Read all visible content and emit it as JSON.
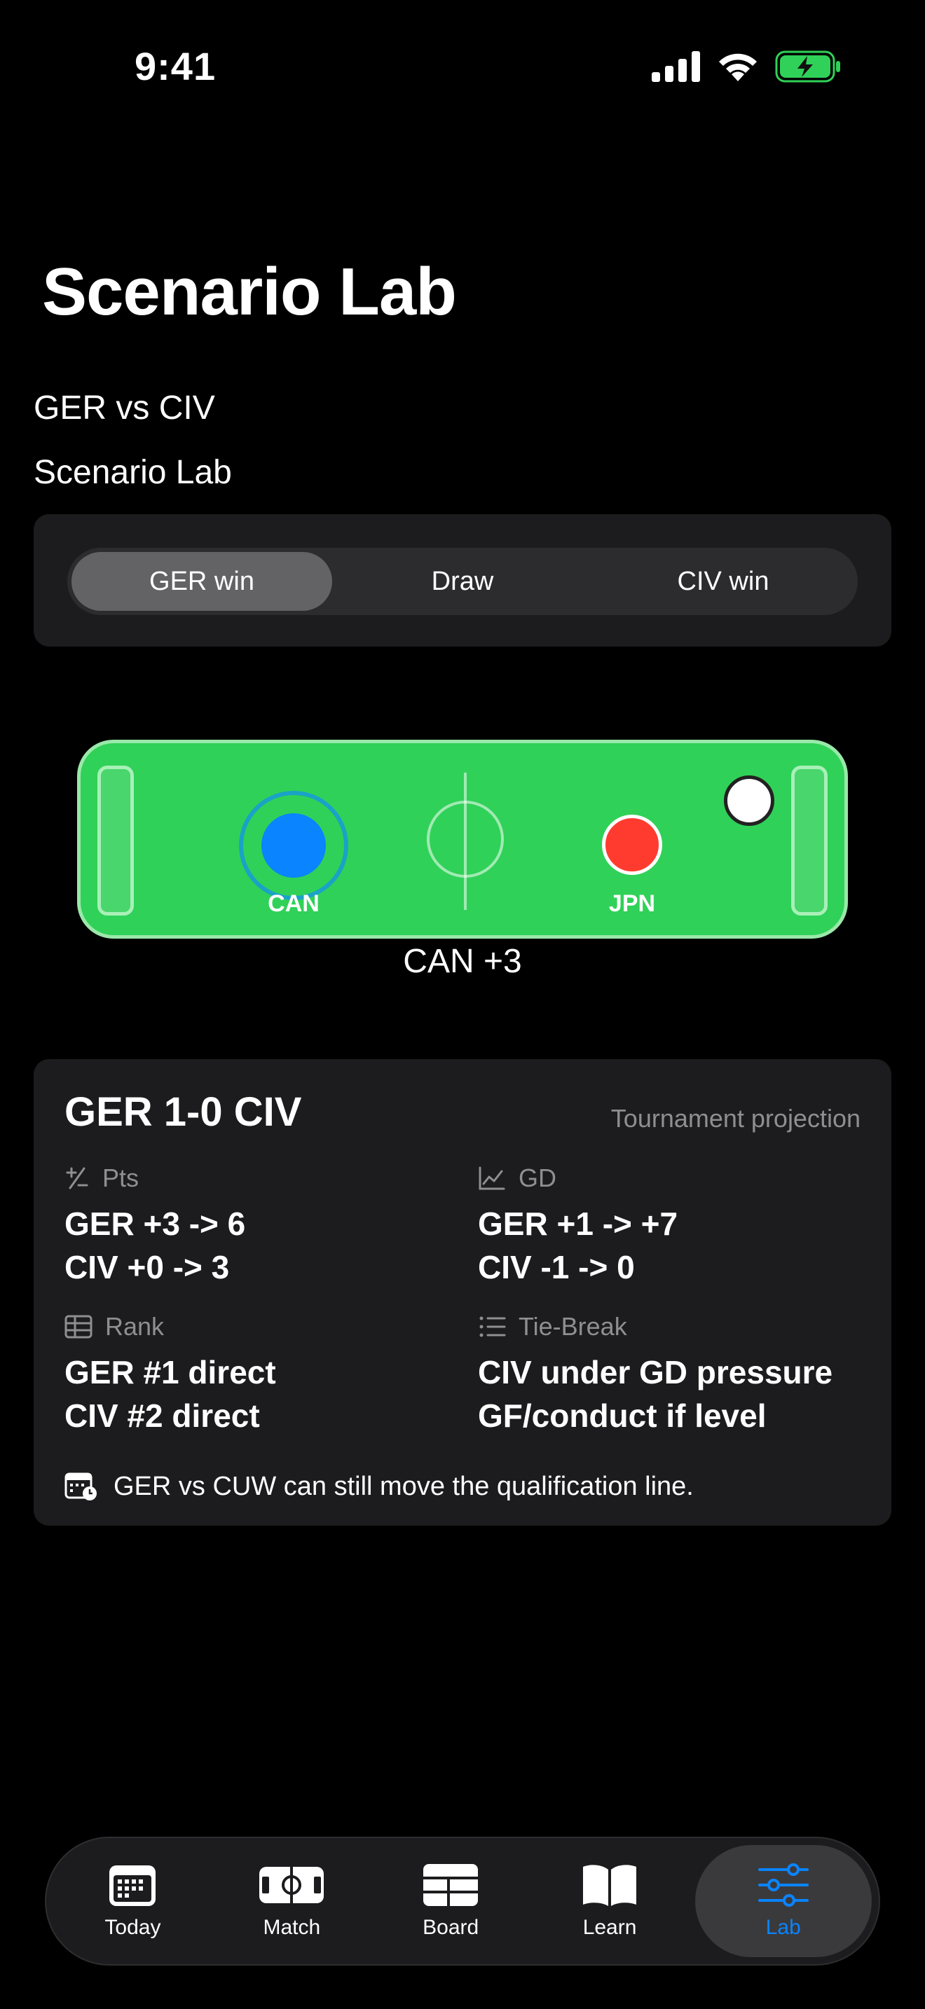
{
  "status": {
    "time": "9:41"
  },
  "header": {
    "large_title": "Scenario Lab",
    "match": "GER vs CIV",
    "section": "Scenario Lab"
  },
  "segmented": {
    "options": [
      "GER win",
      "Draw",
      "CIV win"
    ],
    "selected": "GER win"
  },
  "field": {
    "team_left": "CAN",
    "team_right": "JPN",
    "caption": "CAN +3",
    "colors": {
      "pitch": "#30d158",
      "can": "#0a84ff",
      "jpn": "#ff3b30"
    }
  },
  "projection": {
    "title": "GER 1-0 CIV",
    "tag": "Tournament projection",
    "cells": [
      {
        "label": "Pts",
        "icon": "plus-minus-icon",
        "lines": [
          "GER +3 -> 6",
          "CIV +0 -> 3"
        ]
      },
      {
        "label": "GD",
        "icon": "chart-line-icon",
        "lines": [
          "GER +1 -> +7",
          "CIV -1 -> 0"
        ]
      },
      {
        "label": "Rank",
        "icon": "table-icon",
        "lines": [
          "GER #1 direct",
          "CIV #2 direct"
        ]
      },
      {
        "label": "Tie-Break",
        "icon": "list-number-icon",
        "lines": [
          "CIV under GD pressure",
          "GF/conduct if level"
        ]
      }
    ],
    "note": "GER vs CUW can still move the qualification line."
  },
  "tabs": [
    {
      "label": "Today",
      "icon": "calendar-icon"
    },
    {
      "label": "Match",
      "icon": "pitch-icon"
    },
    {
      "label": "Board",
      "icon": "board-icon"
    },
    {
      "label": "Learn",
      "icon": "book-icon"
    },
    {
      "label": "Lab",
      "icon": "sliders-icon",
      "active": true
    }
  ],
  "accent": "#0a84ff"
}
